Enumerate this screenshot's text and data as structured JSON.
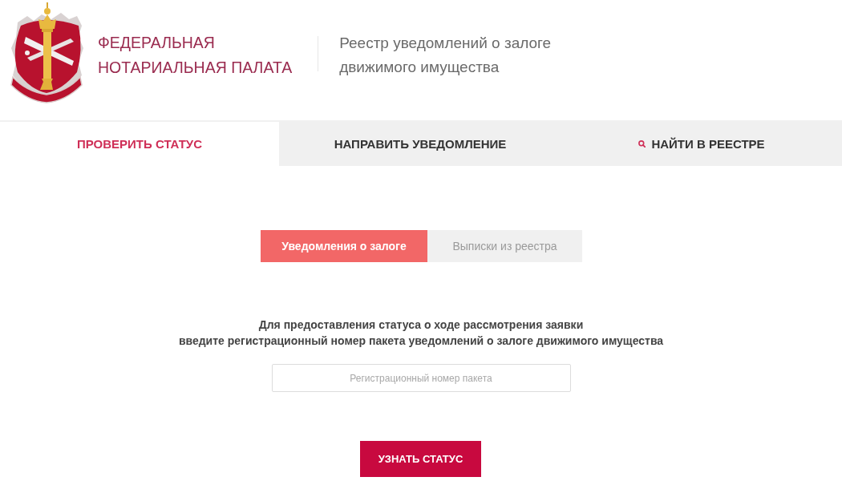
{
  "header": {
    "title_lines": [
      "ФЕДЕРАЛЬНАЯ",
      "НОТАРИАЛЬНАЯ ПАЛАТА"
    ],
    "subtitle_lines": [
      "Реестр уведомлений о залоге",
      "движимого имущества"
    ]
  },
  "nav_tabs": [
    {
      "label": "ПРОВЕРИТЬ СТАТУС",
      "selected": true,
      "kind": "page"
    },
    {
      "label": "НАПРАВИТЬ УВЕДОМЛЕНИЕ",
      "selected": false,
      "kind": "page"
    },
    {
      "label": "НАЙТИ В РЕЕСТРЕ",
      "selected": false,
      "kind": "search"
    }
  ],
  "status_check": {
    "segments": [
      {
        "label": "Уведомления о залоге",
        "selected": true
      },
      {
        "label": "Выписки из реестра",
        "selected": false
      }
    ],
    "instruction_lines": [
      "Для предоставления статуса о ходе рассмотрения заявки",
      "введите регистрационный номер пакета уведомлений о залоге движимого имущества"
    ],
    "package_number": {
      "placeholder": "Регистрационный номер пакета"
    },
    "submit_button": "УЗНАТЬ СТАТУС"
  }
}
